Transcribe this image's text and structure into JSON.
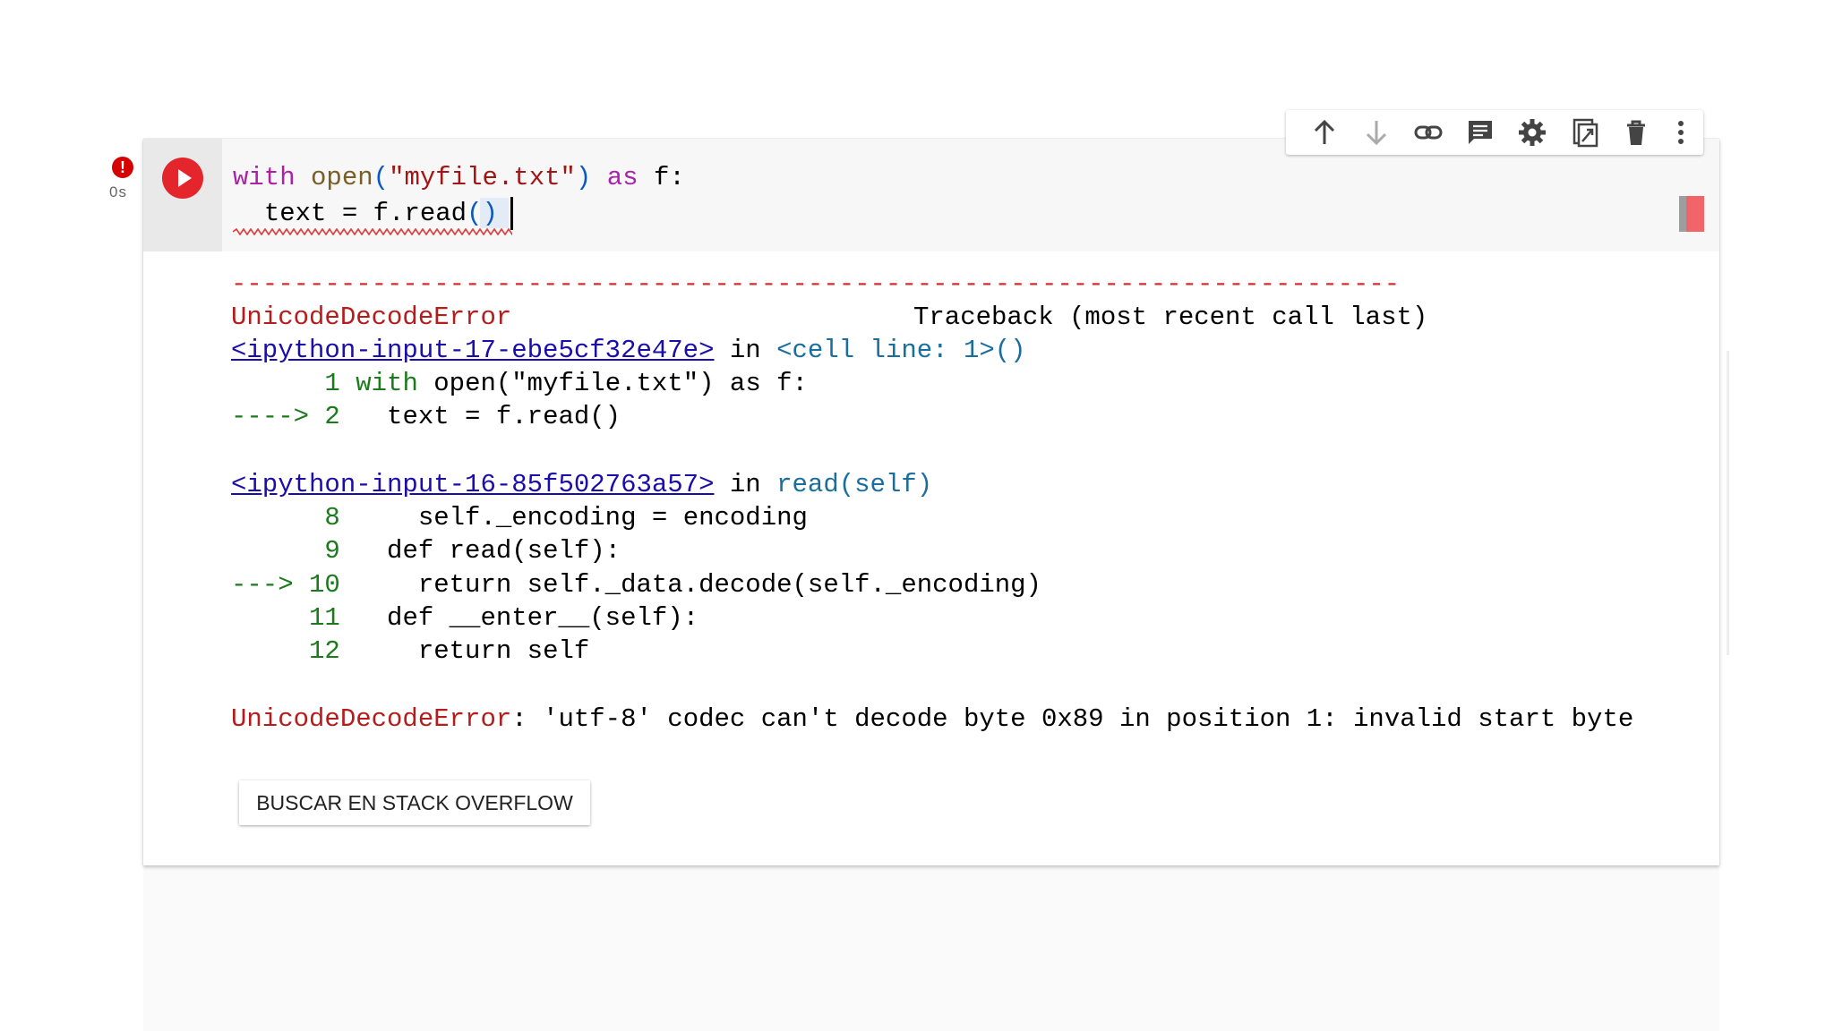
{
  "cell": {
    "execution_status": "!",
    "execution_time": "0s",
    "code_lines": [
      {
        "kw1": "with",
        "fn": "open",
        "p1": "(",
        "str": "\"myfile.txt\"",
        "p2": ")",
        "kw2": "as",
        "rest": "f:"
      },
      {
        "indent": "  ",
        "text": "text = f.read",
        "parens": "()"
      }
    ]
  },
  "toolbar": {
    "buttons": [
      "arrow-up-icon",
      "arrow-down-icon",
      "link-icon",
      "comment-icon",
      "gear-icon",
      "mirror-cell-icon",
      "trash-icon",
      "more-vert-icon"
    ]
  },
  "output": {
    "dashes": "---------------------------------------------------------------------------",
    "error_name": "UnicodeDecodeError",
    "traceback_header": "Traceback (most recent call last)",
    "frames": [
      {
        "link": "<ipython-input-17-ebe5cf32e47e>",
        "in_text": "in",
        "location": "<cell line: 1>()",
        "lines": [
          {
            "marker": "      1",
            "code_kw": "with",
            "code": " open(\"myfile.txt\") as f:"
          },
          {
            "marker": "----> 2",
            "code_kw": "",
            "code": "   text = f.read()"
          }
        ]
      },
      {
        "link": "<ipython-input-16-85f502763a57>",
        "in_text": "in",
        "location": "read(self)",
        "lines": [
          {
            "marker": "      8",
            "code": "     self._encoding = encoding"
          },
          {
            "marker": "      9",
            "code": "   def read(self):"
          },
          {
            "marker": "---> 10",
            "code": "     return self._data.decode(self._encoding)"
          },
          {
            "marker": "     11",
            "code": "   def __enter__(self):"
          },
          {
            "marker": "     12",
            "code": "     return self"
          }
        ]
      }
    ],
    "final_error_name": "UnicodeDecodeError",
    "final_error_message": ": 'utf-8' codec can't decode byte 0x89 in position 1: invalid start byte"
  },
  "stack_overflow_button": "BUSCAR EN STACK OVERFLOW"
}
